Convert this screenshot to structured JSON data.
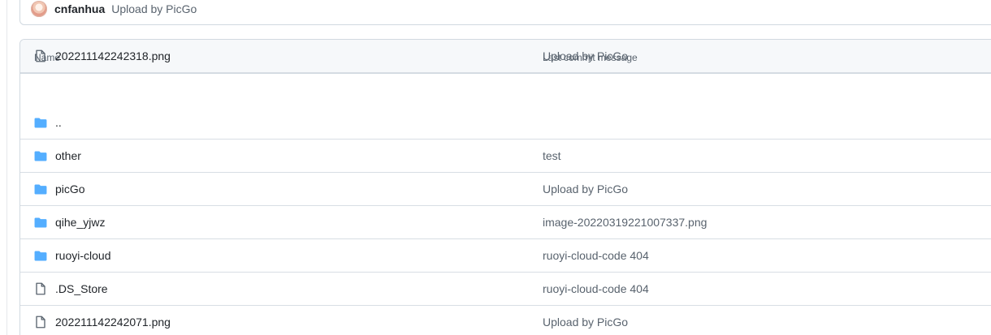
{
  "latest_commit": {
    "author": "cnfanhua",
    "message": "Upload by PicGo",
    "avatar_icon": "author-avatar"
  },
  "file_table": {
    "headers": {
      "name": "Name",
      "last_commit_message": "Last commit message"
    },
    "rows": [
      {
        "name": "..",
        "type": "folder",
        "commit_message": ""
      },
      {
        "name": "other",
        "type": "folder",
        "commit_message": "test"
      },
      {
        "name": "picGo",
        "type": "folder",
        "commit_message": "Upload by PicGo"
      },
      {
        "name": "qihe_yjwz",
        "type": "folder",
        "commit_message": "image-20220319221007337.png"
      },
      {
        "name": "ruoyi-cloud",
        "type": "folder",
        "commit_message": "ruoyi-cloud-code 404"
      },
      {
        "name": ".DS_Store",
        "type": "file",
        "commit_message": "ruoyi-cloud-code 404"
      },
      {
        "name": "202211142242071.png",
        "type": "file",
        "commit_message": "Upload by PicGo"
      },
      {
        "name": "202211142242318.png",
        "type": "file",
        "commit_message": "Upload by PicGo"
      }
    ]
  },
  "colors": {
    "folder_icon": "#54aeff",
    "file_icon": "#59636e",
    "header_background": "#f6f8fa",
    "border": "#d1d9e0"
  }
}
